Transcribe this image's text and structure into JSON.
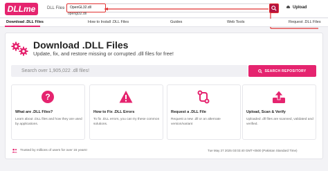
{
  "header": {
    "logo": "DLLme",
    "breadcrumb": "DLL Files",
    "search_value": "OpenGL32.dll",
    "search_suggestion": "opengl32.dll",
    "upload_label": "Upload",
    "accent": "#e5246f",
    "highlight": "#e03030"
  },
  "nav": {
    "items": [
      {
        "label": "Download .DLL Files"
      },
      {
        "label": "How to Install .DLL Files"
      },
      {
        "label": "Guides"
      },
      {
        "label": "Web Tools"
      },
      {
        "label": "Request .DLL Files"
      }
    ]
  },
  "hero": {
    "title": "Download .DLL Files",
    "subtitle": "Update, fix, and restore missing or corrupted .dll files for free!",
    "search_placeholder": "Search over 1,905,022 .dll files!",
    "search_button": "SEARCH REPOSITORY"
  },
  "features": [
    {
      "icon": "question-icon",
      "title": "What are .DLL Files?",
      "desc": "Learn about .DLL files and how they are used by applications."
    },
    {
      "icon": "warning-icon",
      "title": "How to Fix .DLL Errors",
      "desc": "To fix .DLL errors, you can try these common solutions."
    },
    {
      "icon": "request-icon",
      "title": "Request a .DLL File",
      "desc": "Request a new .dll or an alternate version/variant"
    },
    {
      "icon": "upload-icon",
      "title": "Upload, Scan & Verify",
      "desc": "Uploaded .dll files are scanned, validated and verified."
    }
  ],
  "footer": {
    "trust": "Trusted by millions of users for over 15 years!",
    "timestamp": "Tue May 27 2025 03:03:40 GMT+0500 (Pakistan Standard Time)"
  }
}
